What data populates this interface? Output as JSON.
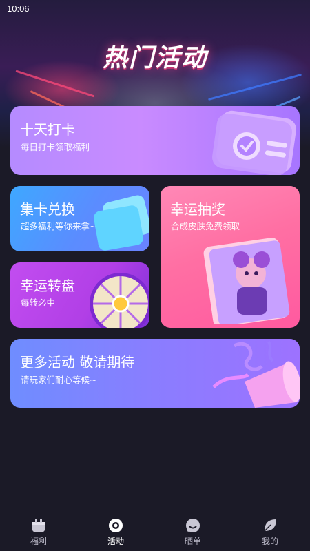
{
  "status_bar": {
    "time": "10:06"
  },
  "header": {
    "title": "热门活动"
  },
  "cards": {
    "checkin": {
      "title": "十天打卡",
      "subtitle": "每日打卡领取福利"
    },
    "collect": {
      "title": "集卡兑换",
      "subtitle": "超多福利等你来拿~"
    },
    "wheel": {
      "title": "幸运转盘",
      "subtitle": "每转必中"
    },
    "lottery": {
      "title": "幸运抽奖",
      "subtitle": "合成皮肤免费领取"
    },
    "more": {
      "title": "更多活动 敬请期待",
      "subtitle": "请玩家们耐心等候~"
    }
  },
  "tabbar": {
    "items": [
      {
        "label": "福利",
        "icon": "gift-box-icon",
        "active": false
      },
      {
        "label": "活动",
        "icon": "activity-target-icon",
        "active": true
      },
      {
        "label": "晒单",
        "icon": "chat-bubble-icon",
        "active": false
      },
      {
        "label": "我的",
        "icon": "profile-leaf-icon",
        "active": false
      }
    ]
  },
  "colors": {
    "background": "#1b1a27",
    "checkin": "#b58bff",
    "collect": "#3ea8ff",
    "wheel": "#c24df0",
    "lottery": "#ff6fa3",
    "more": "#7f86ff"
  }
}
